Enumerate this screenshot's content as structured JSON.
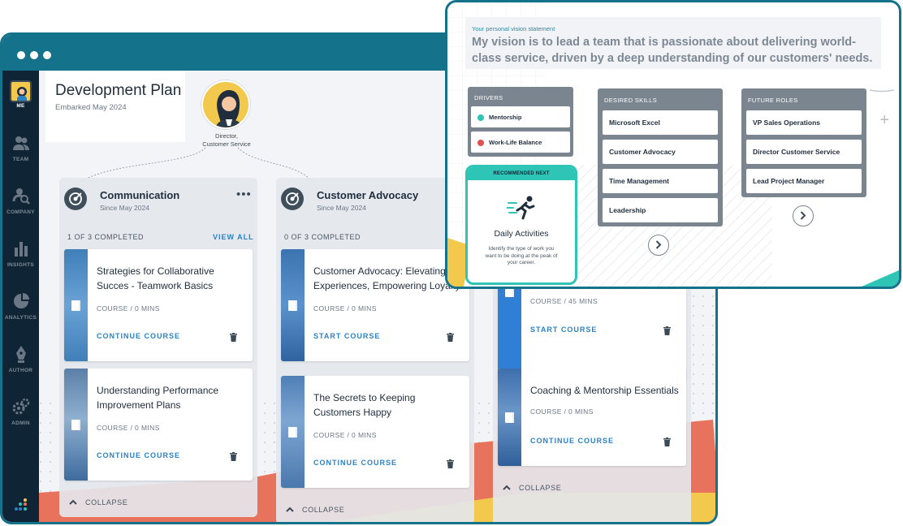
{
  "app": {
    "sidebar": {
      "items": [
        {
          "key": "me",
          "label": "ME",
          "icon": "user-avatar"
        },
        {
          "key": "team",
          "label": "TEAM",
          "icon": "team-icon"
        },
        {
          "key": "company",
          "label": "COMPANY",
          "icon": "company-search-icon"
        },
        {
          "key": "insights",
          "label": "INSIGHTS",
          "icon": "bar-chart-icon"
        },
        {
          "key": "analytics",
          "label": "ANALYTICS",
          "icon": "pie-chart-icon"
        },
        {
          "key": "author",
          "label": "AUTHOR",
          "icon": "pen-nib-icon"
        },
        {
          "key": "admin",
          "label": "ADMIN",
          "icon": "gears-icon"
        }
      ]
    },
    "header": {
      "title": "Development Plan",
      "subtitle": "Embarked May 2024",
      "role": "Director,\nCustomer Service",
      "role_line1": "Director,",
      "role_line2": "Customer Service"
    },
    "columns": [
      {
        "title": "Communication",
        "since": "Since May 2024",
        "completed": "1 of 3 COMPLETED",
        "view_all": "VIEW ALL",
        "courses": [
          {
            "title": "Strategies for Collaborative Succes - Teamwork Basics",
            "meta": "COURSE / 0 MINS",
            "action": "CONTINUE COURSE"
          },
          {
            "title": "Understanding Performance Improvement Plans",
            "meta": "COURSE / 0 MINS",
            "action": "CONTINUE COURSE"
          }
        ],
        "collapse": "COLLAPSE"
      },
      {
        "title": "Customer Advocacy",
        "since": "Since May 2024",
        "completed": "0 of 3 COMPLETED",
        "courses": [
          {
            "title": "Customer Advocacy: Elevating Experiences, Empowering Loyalty",
            "meta": "COURSE / 0 MINS",
            "action": "START COURSE"
          },
          {
            "title": "The Secrets to Keeping Customers Happy",
            "meta": "COURSE / 0 MINS",
            "action": "CONTINUE COURSE"
          }
        ],
        "collapse": "COLLAPSE"
      },
      {
        "courses": [
          {
            "title": "",
            "meta": "COURSE / 45 MINS",
            "action": "START COURSE"
          },
          {
            "title": "Coaching & Mentorship Essentials",
            "meta": "COURSE / 0 MINS",
            "action": "CONTINUE COURSE"
          }
        ],
        "collapse": "COLLAPSE"
      }
    ]
  },
  "vision": {
    "label": "Your personal vision statement",
    "text": "My vision is to lead a team that is passionate about delivering world-class service, driven by a deep understanding of our customers' needs.",
    "drivers": {
      "title": "DRIVERS",
      "items": [
        {
          "label": "Mentorship",
          "status_color": "#2ec4b6"
        },
        {
          "label": "Work-Life Balance",
          "status_color": "#e05252"
        }
      ]
    },
    "recommended": {
      "header": "RECOMMENDED NEXT",
      "title": "Daily Activities",
      "description": "Identify the type of work you want to be doing at the peak of your career."
    },
    "desired_skills": {
      "title": "DESIRED SKILLS",
      "items": [
        "Microsoft Excel",
        "Customer Advocacy",
        "Time Management",
        "Leadership"
      ]
    },
    "future_roles": {
      "title": "FUTURE ROLES",
      "items": [
        "VP Sales Operations",
        "Director Customer Service",
        "Lead Project Manager"
      ]
    }
  },
  "colors": {
    "brand": "#14728b",
    "sidebar": "#0f2535",
    "link": "#2b82c4",
    "accent_teal": "#2ec4b6",
    "coral": "#e8735c",
    "gold": "#f2c94c"
  }
}
